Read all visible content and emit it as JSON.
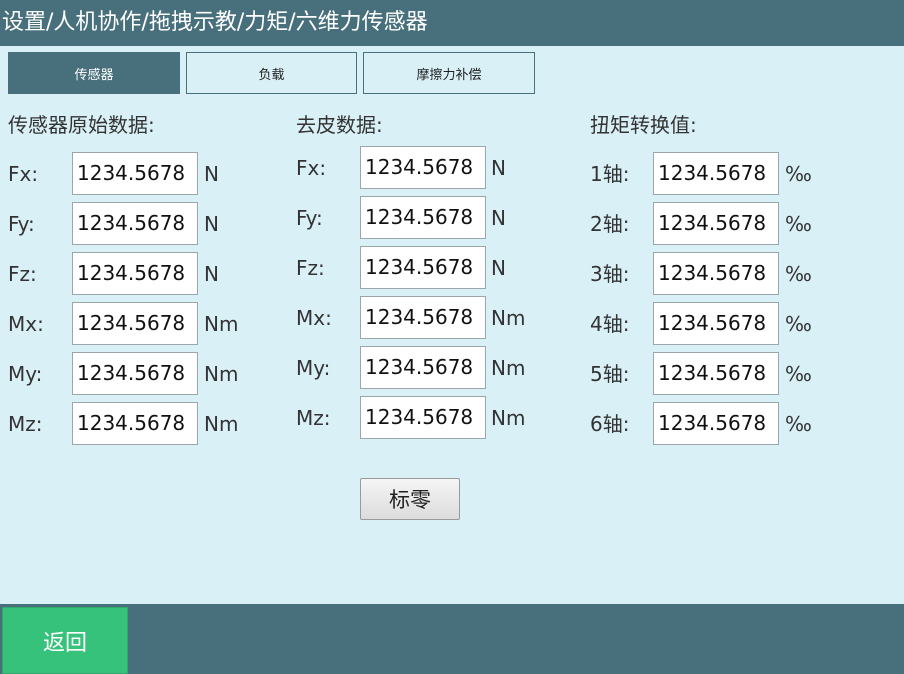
{
  "header": {
    "title": "设置/人机协作/拖拽示教/力矩/六维力传感器"
  },
  "tabs": [
    {
      "label": "传感器",
      "active": true
    },
    {
      "label": "负载",
      "active": false
    },
    {
      "label": "摩擦力补偿",
      "active": false
    }
  ],
  "sections": {
    "raw": {
      "title": "传感器原始数据:",
      "rows": [
        {
          "label": "Fx:",
          "value": "1234.5678",
          "unit": "N"
        },
        {
          "label": "Fy:",
          "value": "1234.5678",
          "unit": "N"
        },
        {
          "label": "Fz:",
          "value": "1234.5678",
          "unit": "N"
        },
        {
          "label": "Mx:",
          "value": "1234.5678",
          "unit": "Nm"
        },
        {
          "label": "My:",
          "value": "1234.5678",
          "unit": "Nm"
        },
        {
          "label": "Mz:",
          "value": "1234.5678",
          "unit": "Nm"
        }
      ]
    },
    "tare": {
      "title": "去皮数据:",
      "rows": [
        {
          "label": "Fx:",
          "value": "1234.5678",
          "unit": "N"
        },
        {
          "label": "Fy:",
          "value": "1234.5678",
          "unit": "N"
        },
        {
          "label": "Fz:",
          "value": "1234.5678",
          "unit": "N"
        },
        {
          "label": "Mx:",
          "value": "1234.5678",
          "unit": "Nm"
        },
        {
          "label": "My:",
          "value": "1234.5678",
          "unit": "Nm"
        },
        {
          "label": "Mz:",
          "value": "1234.5678",
          "unit": "Nm"
        }
      ]
    },
    "torque": {
      "title": "扭矩转换值:",
      "rows": [
        {
          "label": "1轴:",
          "value": "1234.5678",
          "unit": "‰"
        },
        {
          "label": "2轴:",
          "value": "1234.5678",
          "unit": "‰"
        },
        {
          "label": "3轴:",
          "value": "1234.5678",
          "unit": "‰"
        },
        {
          "label": "4轴:",
          "value": "1234.5678",
          "unit": "‰"
        },
        {
          "label": "5轴:",
          "value": "1234.5678",
          "unit": "‰"
        },
        {
          "label": "6轴:",
          "value": "1234.5678",
          "unit": "‰"
        }
      ]
    }
  },
  "actions": {
    "zero_label": "标零",
    "back_label": "返回"
  },
  "colors": {
    "header_bg": "#48707c",
    "content_bg": "#d9f0f6",
    "back_button": "#36c27a"
  }
}
